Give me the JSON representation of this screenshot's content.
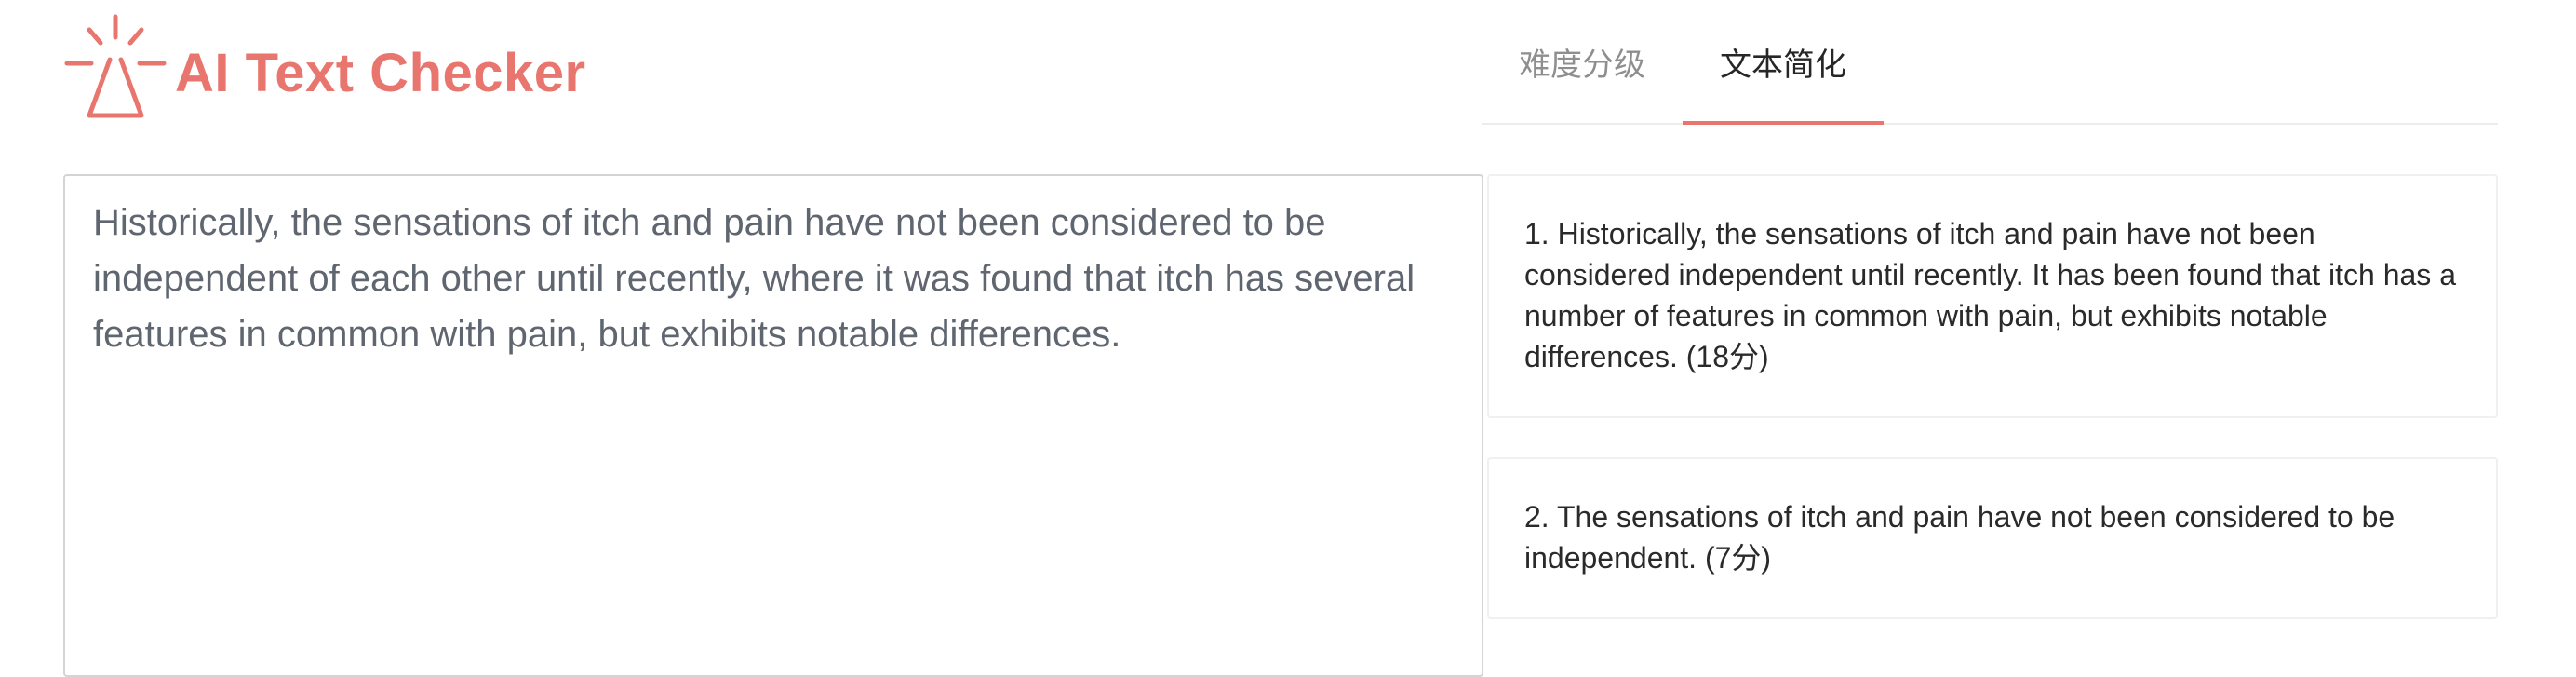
{
  "brand": {
    "title": "AI Text Checker",
    "icon": "lamp-light-icon",
    "color": "#e8756e"
  },
  "tabs": [
    {
      "label": "难度分级",
      "active": false
    },
    {
      "label": "文本简化",
      "active": true
    }
  ],
  "input": {
    "value": "Historically, the sensations of itch and pain have not been considered to be independent of each other until recently, where it was found that itch has several features in common with pain, but exhibits notable differences."
  },
  "results": [
    {
      "text": "1. Historically, the sensations of itch and pain have not been considered independent until recently. It has been found that itch has a number of features in common with pain, but exhibits notable differences.",
      "score": "(18分)"
    },
    {
      "text": "2. The sensations of itch and pain have not been considered to be independent.",
      "score": "(7分)"
    }
  ],
  "colors": {
    "accent": "#e8756e",
    "tab_active": "#262626",
    "tab_inactive": "#8e8e8e",
    "input_text": "#5f6670"
  }
}
